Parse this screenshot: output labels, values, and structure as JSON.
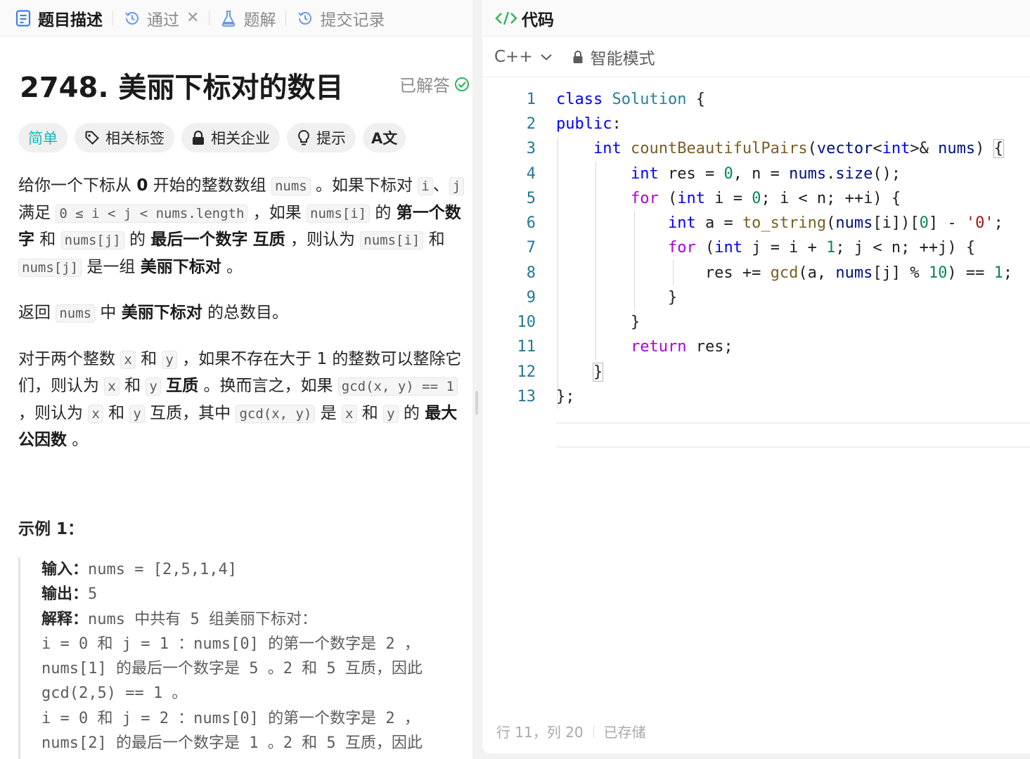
{
  "left_tabs": [
    {
      "label": "题目描述",
      "icon": "document-icon"
    },
    {
      "label": "通过",
      "icon": "history-icon"
    },
    {
      "label": "题解",
      "icon": "flask-icon"
    },
    {
      "label": "提交记录",
      "icon": "history-icon"
    }
  ],
  "problem": {
    "title": "2748. 美丽下标对的数目",
    "status": "已解答"
  },
  "tags": {
    "difficulty": "简单",
    "related_tags": "相关标签",
    "related_companies": "相关企业",
    "hint": "提示",
    "translate": "A文"
  },
  "description": {
    "p1": {
      "t1": "给你一个下标从 ",
      "zero": "0",
      "t2": " 开始的整数数组 ",
      "c1": "nums",
      "t3": " 。如果下标对 ",
      "c2": "i",
      "t4": "、",
      "c3": "j",
      "t5": " 满足 ",
      "c4": "0 ≤ i < j < nums.length",
      "t6": " ，如果 ",
      "c5": "nums[i]",
      "t7": " 的 ",
      "b1": "第一个数字",
      "t8": " 和 ",
      "c6": "nums[j]",
      "t9": " 的 ",
      "b2": "最后一个数字",
      "t10": " ",
      "b3": "互质",
      "t11": " ，则认为 ",
      "c7": "nums[i]",
      "t12": " 和 ",
      "c8": "nums[j]",
      "t13": " 是一组 ",
      "b4": "美丽下标对",
      "t14": " 。"
    },
    "p2": {
      "t1": "返回 ",
      "c1": "nums",
      "t2": " 中 ",
      "b1": "美丽下标对",
      "t3": " 的总数目。"
    },
    "p3": {
      "t1": "对于两个整数 ",
      "c1": "x",
      "t2": " 和 ",
      "c2": "y",
      "t3": " ，如果不存在大于 1 的整数可以整除它们，则认为 ",
      "c3": "x",
      "t4": " 和 ",
      "c4": "y",
      "t5": " ",
      "b1": "互质",
      "t6": " 。换而言之，如果 ",
      "c5": "gcd(x, y) == 1",
      "t7": " ，则认为 ",
      "c6": "x",
      "t8": " 和 ",
      "c7": "y",
      "t9": " 互质，其中 ",
      "c8": "gcd(x, y)",
      "t10": " 是 ",
      "c9": "x",
      "t11": " 和 ",
      "c10": "y",
      "t12": " 的 ",
      "b2": "最大公因数",
      "t13": " 。"
    }
  },
  "example": {
    "title": "示例 1：",
    "input_label": "输入：",
    "input_value": "nums = [2,5,1,4]",
    "output_label": "输出：",
    "output_value": "5",
    "explain_label": "解释：",
    "explain_value": "nums 中共有 5 组美丽下标对：",
    "lines": [
      "i = 0 和 j = 1 ：nums[0] 的第一个数字是 2 ，",
      "nums[1] 的最后一个数字是 5 。2 和 5 互质，因此",
      "gcd(2,5) == 1 。",
      "i = 0 和 j = 2 ：nums[0] 的第一个数字是 2 ，",
      "nums[2] 的最后一个数字是 1 。2 和 5 互质，因此"
    ]
  },
  "editor": {
    "header": "代码",
    "language": "C++",
    "mode": "智能模式",
    "line_numbers": [
      "1",
      "2",
      "3",
      "4",
      "5",
      "6",
      "7",
      "8",
      "9",
      "10",
      "11",
      "12",
      "13"
    ],
    "code_lines": [
      "class Solution {",
      "public:",
      "    int countBeautifulPairs(vector<int>& nums) {",
      "        int res = 0, n = nums.size();",
      "        for (int i = 0; i < n; ++i) {",
      "            int a = to_string(nums[i])[0] - '0';",
      "            for (int j = i + 1; j < n; ++j) {",
      "                res += gcd(a, nums[j] % 10) == 1;",
      "            }",
      "        }",
      "        return res;",
      "    }",
      "};"
    ],
    "cursor_position": "行 11，列 20",
    "save_status": "已存储"
  },
  "colors": {
    "easy": "#1cb8b8",
    "solved_check": "#2db55d",
    "code_icon": "#2db55d",
    "line_number": "#237893",
    "keyword": "#0000ff",
    "control": "#af00db"
  }
}
